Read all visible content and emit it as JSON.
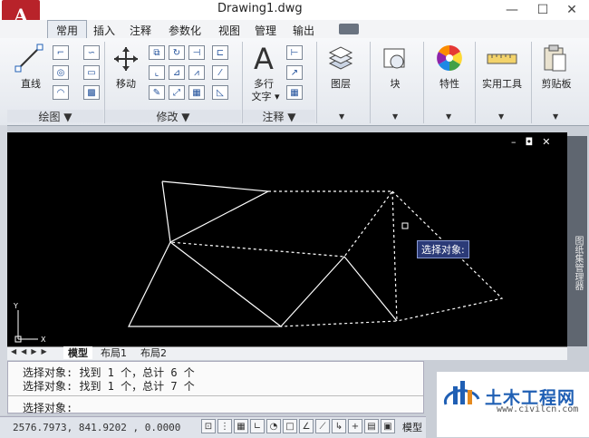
{
  "window": {
    "title": "Drawing1.dwg",
    "controls": [
      "—",
      "☐",
      "✕"
    ]
  },
  "app_button": {
    "letter": "A",
    "caret": "▼"
  },
  "ribbon": {
    "tabs": [
      "常用",
      "插入",
      "注释",
      "参数化",
      "视图",
      "管理",
      "输出"
    ],
    "active_tab": "常用",
    "panels": {
      "draw": {
        "label": "绘图 ▼",
        "big": "直线"
      },
      "modify": {
        "label": "修改 ▼",
        "big": "移动"
      },
      "annotation": {
        "label": "注释 ▼",
        "big_glyph": "A",
        "big": "多行",
        "big2": "文字 ▾"
      },
      "layers": {
        "big": "图层",
        "caret": "▼"
      },
      "block": {
        "big": "块",
        "caret": "▼"
      },
      "properties": {
        "big": "特性",
        "caret": "▼"
      },
      "utilities": {
        "big": "实用工具",
        "caret": "▼"
      },
      "clipboard": {
        "big": "剪贴板",
        "caret": "▼"
      }
    }
  },
  "drawing": {
    "viewport_controls": [
      "–",
      "◘",
      "✕"
    ],
    "axis_x": "X",
    "axis_y": "Y",
    "prompt_box": "选择对象:",
    "palette_label": "图纸集管理器"
  },
  "layout_tabs": {
    "nav": [
      "◀",
      "◀",
      "▶",
      "▶"
    ],
    "tabs": [
      "模型",
      "布局1",
      "布局2"
    ],
    "active": "模型"
  },
  "command": {
    "history": [
      "选择对象: 找到 1 个，总计 6 个",
      "选择对象: 找到 1 个，总计 7 个"
    ],
    "current": "选择对象:"
  },
  "status_bar": {
    "coordinates": "2576.7973, 841.9202 , 0.0000",
    "model_label": "模型"
  },
  "watermark": {
    "name": "土木工程网",
    "url": "www.civilcn.com"
  },
  "colors": {
    "app_red": "#b8232a",
    "canvas": "#000000",
    "line": "#ffffff",
    "prompt_bg": "#2b3a77"
  }
}
